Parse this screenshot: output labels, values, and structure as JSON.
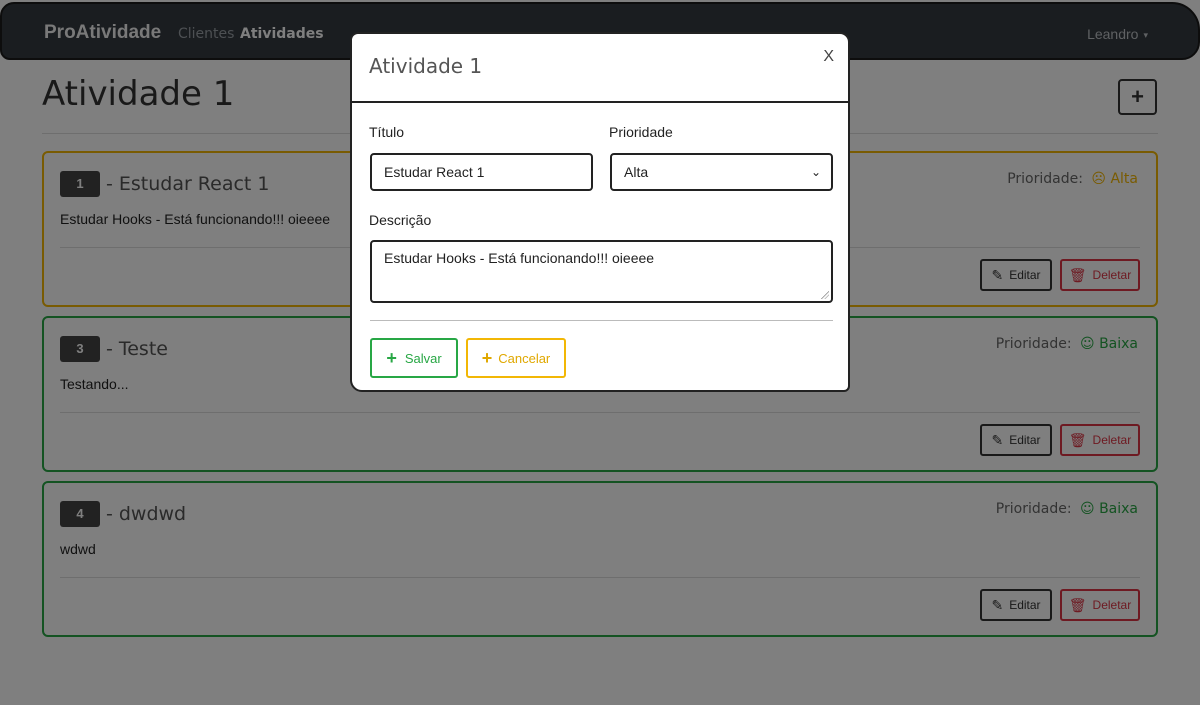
{
  "navbar": {
    "brand": "ProAtividade",
    "links": [
      "Clientes",
      "Atividades"
    ],
    "user": "Leandro",
    "user_caret": "▾"
  },
  "page": {
    "title": "Atividade 1",
    "add_button": "+"
  },
  "cards": [
    {
      "number": "1",
      "title": "Estudar React 1",
      "description": "Estudar Hooks - Está funcionando!!! oieeee",
      "priority_label": "Prioridade:",
      "priority": "Alta",
      "priority_face": "☹",
      "color": "#f2b705"
    },
    {
      "number": "3",
      "title": "Teste",
      "description": "Testando...",
      "priority_label": "Prioridade:",
      "priority": "Baixa",
      "priority_face": "☺",
      "color": "#28a745"
    },
    {
      "number": "4",
      "title": "dwdwd",
      "description": "wdwd",
      "priority_label": "Prioridade:",
      "priority": "Baixa",
      "priority_face": "☺",
      "color": "#28a745"
    }
  ],
  "card_actions": {
    "edit_label": "Editar",
    "edit_icon": "pencil-icon",
    "delete_label": "Deletar",
    "delete_icon": "trash-icon",
    "separator": "-"
  },
  "modal": {
    "title": "Atividade 1",
    "close": "X",
    "titulo_label": "Título",
    "titulo_value": "Estudar React 1",
    "prioridade_label": "Prioridade",
    "prioridade_value": "Alta",
    "descricao_label": "Descrição",
    "descricao_value": "Estudar Hooks - Está funcionando!!! oieeee",
    "save_label": "Salvar",
    "cancel_label": "Cancelar"
  },
  "colors": {
    "navbar": "#343a40",
    "high_priority": "#f2b705",
    "low_priority": "#28a745",
    "danger": "#dc3545"
  }
}
